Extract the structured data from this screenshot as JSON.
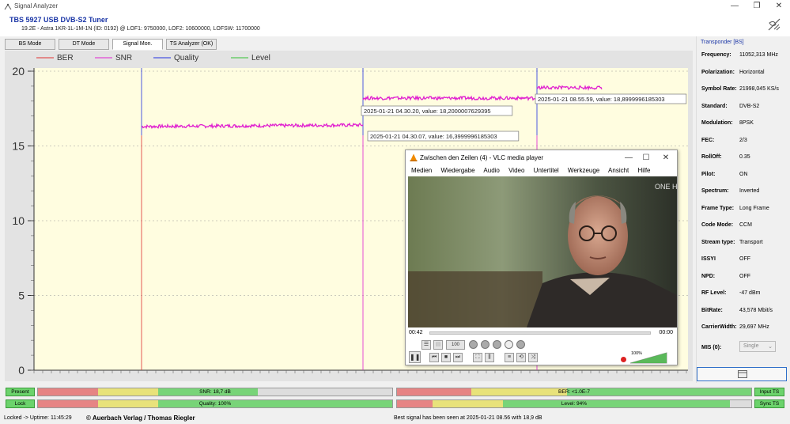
{
  "window": {
    "title": "Signal Analyzer",
    "minimize": "—",
    "maximize": "❐",
    "close": "✕"
  },
  "header": {
    "device": "TBS 5927 USB DVB-S2 Tuner",
    "subtitle": "19.2E - Astra 1KR-1L-1M-1N (ID: 0192) @ LOF1: 9750000, LOF2: 10600000, LOFSW: 11700000"
  },
  "tabs": [
    "BS Mode",
    "DT Mode",
    "Signal Mon.",
    "TS Analyzer (OK)"
  ],
  "active_tab": "Signal Mon.",
  "chart_data": {
    "type": "line",
    "legend": [
      {
        "name": "BER",
        "color": "#e03030"
      },
      {
        "name": "SNR",
        "color": "#e020d0"
      },
      {
        "name": "Quality",
        "color": "#2030e0"
      },
      {
        "name": "Level",
        "color": "#30c030"
      }
    ],
    "ylim": [
      0,
      20
    ],
    "yticks": [
      0,
      5,
      10,
      15,
      20
    ],
    "grid": true,
    "snr_segments": [
      {
        "y_start": 16.3,
        "y_end": 16.4
      },
      {
        "y_start": 18.2,
        "y_end": 18.2
      },
      {
        "y_start": 18.9,
        "y_end": 18.9
      }
    ],
    "tooltips": [
      "2025-01-21 04.30.20, value: 18,2000007629395",
      "2025-01-21 04.30.07, value: 16,3999996185303",
      "2025-01-21 08.55.59, value: 18,8999996185303"
    ],
    "background": "#fffde0"
  },
  "transponder": {
    "title": "Transponder [BS]",
    "rows": [
      {
        "k": "Frequency:",
        "v": "11052,313 MHz"
      },
      {
        "k": "Polarization:",
        "v": "Horizontal"
      },
      {
        "k": "Symbol Rate:",
        "v": "21998,045 KS/s"
      },
      {
        "k": "Standard:",
        "v": "DVB-S2"
      },
      {
        "k": "Modulation:",
        "v": "8PSK"
      },
      {
        "k": "FEC:",
        "v": "2/3"
      },
      {
        "k": "RollOff:",
        "v": "0.35"
      },
      {
        "k": "Pilot:",
        "v": "ON"
      },
      {
        "k": "Spectrum:",
        "v": "Inverted"
      },
      {
        "k": "Frame Type:",
        "v": "Long Frame"
      },
      {
        "k": "Code Mode:",
        "v": "CCM"
      },
      {
        "k": "Stream type:",
        "v": "Transport"
      },
      {
        "k": "ISSYI",
        "v": "OFF"
      },
      {
        "k": "NPD:",
        "v": "OFF"
      },
      {
        "k": "RF Level:",
        "v": "-47 dBm"
      },
      {
        "k": "BitRate:",
        "v": "43,578 Mbit/s"
      },
      {
        "k": "CarrierWidth:",
        "v": "29,697 MHz"
      }
    ],
    "mis_label": "MIS (0):",
    "mis_value": "Single"
  },
  "vlc": {
    "title": "Zwischen den Zeilen (4) - VLC media player",
    "menu": [
      "Medien",
      "Wiedergabe",
      "Audio",
      "Video",
      "Untertitel",
      "Werkzeuge",
      "Ansicht",
      "Hilfe"
    ],
    "time_elapsed": "00:42",
    "time_total": "00:00",
    "speed": "100",
    "volume": "100%",
    "channel_logo": "ONE HD"
  },
  "status": {
    "present": "Present",
    "lock": "Lock",
    "input_ts": "Input TS",
    "sync_ts": "Sync TS",
    "snr": {
      "label": "SNR: 18,7 dB",
      "fill": 0.62
    },
    "quality": {
      "label": "Quality: 100%",
      "fill": 1.0
    },
    "ber": {
      "label": "BER: <1.0E-7",
      "fill": 1.0
    },
    "level": {
      "label": "Level: 94%",
      "fill": 0.94
    }
  },
  "footer": {
    "uptime": "Locked -> Uptime: 11:45:29",
    "copyright": "© Auerbach Verlag / Thomas Riegler",
    "best": "Best signal has been seen at 2025-01-21 08.56 with 18,9 dB"
  }
}
